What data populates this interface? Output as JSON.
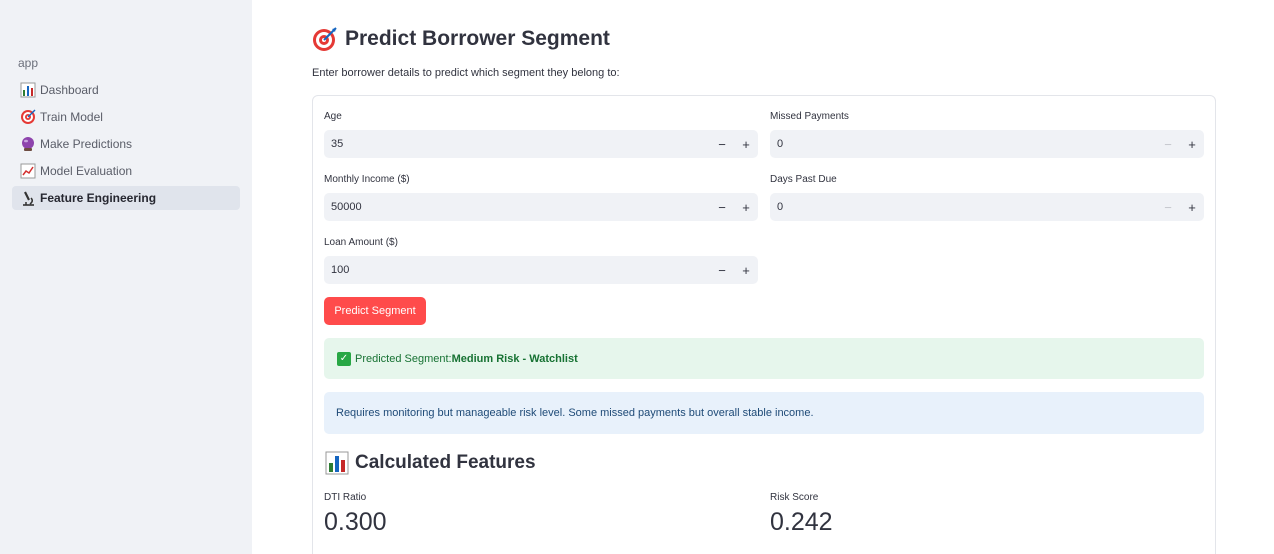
{
  "sidebar": {
    "app_label": "app",
    "items": [
      {
        "label": "Dashboard",
        "icon": "bar-chart-icon"
      },
      {
        "label": "Train Model",
        "icon": "target-icon"
      },
      {
        "label": "Make Predictions",
        "icon": "crystal-ball-icon"
      },
      {
        "label": "Model Evaluation",
        "icon": "line-chart-icon"
      },
      {
        "label": "Feature Engineering",
        "icon": "microscope-icon",
        "active": true
      }
    ]
  },
  "page": {
    "title": "Predict Borrower Segment",
    "intro": "Enter borrower details to predict which segment they belong to:"
  },
  "form": {
    "age": {
      "label": "Age",
      "value": "35"
    },
    "missed_payments": {
      "label": "Missed Payments",
      "value": "0"
    },
    "monthly_income": {
      "label": "Monthly Income ($)",
      "value": "50000"
    },
    "days_past_due": {
      "label": "Days Past Due",
      "value": "0"
    },
    "loan_amount": {
      "label": "Loan Amount ($)",
      "value": "100"
    },
    "stepper": {
      "minus": "−",
      "plus": "+"
    },
    "submit_label": "Predict Segment"
  },
  "result": {
    "prefix": "Predicted Segment: ",
    "segment": "Medium Risk - Watchlist",
    "description": "Requires monitoring but manageable risk level. Some missed payments but overall stable income."
  },
  "features": {
    "title": "Calculated Features",
    "dti_label": "DTI Ratio",
    "dti_value": "0.300",
    "risk_label": "Risk Score",
    "risk_value": "0.242"
  },
  "colors": {
    "primary_button": "#ff4b4b",
    "success_bg": "#e6f6ec",
    "info_bg": "#e8f1fb",
    "sidebar_bg": "#f0f2f6"
  }
}
